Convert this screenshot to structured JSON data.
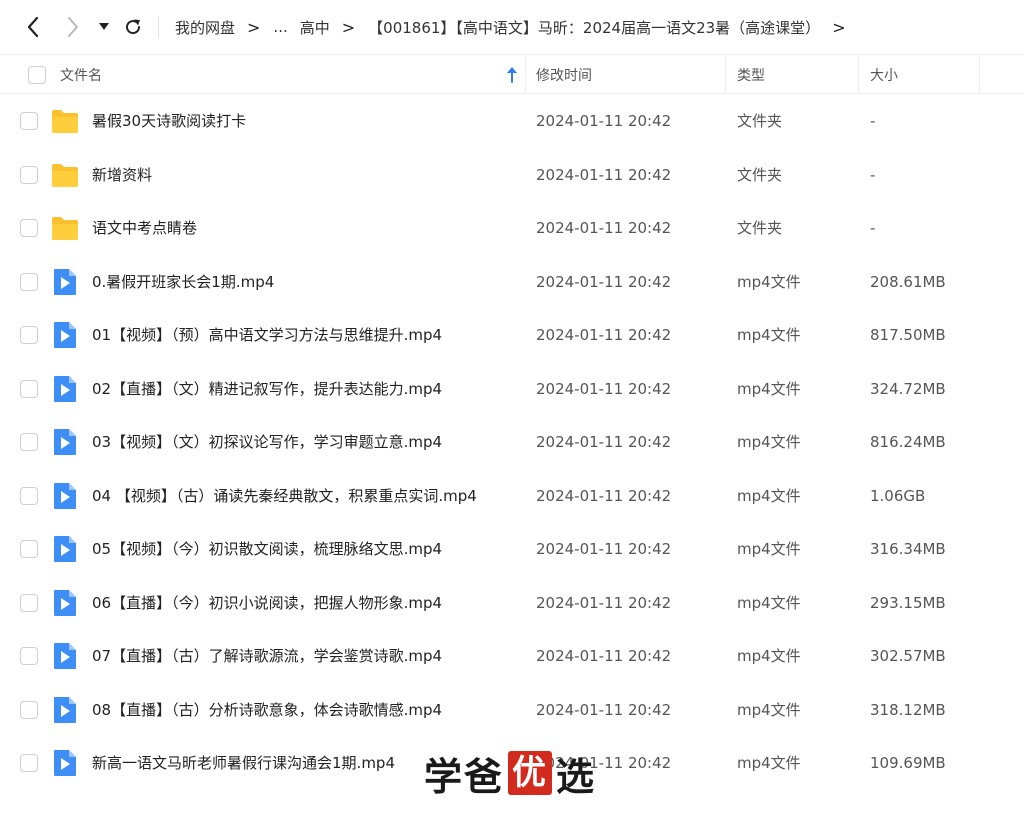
{
  "breadcrumb": {
    "root": "我的网盘",
    "ellipsis": "...",
    "level1": "高中",
    "current": "【001861】【高中语文】马昕：2024届高一语文23暑（高途课堂）"
  },
  "columns": {
    "name": "文件名",
    "modified": "修改时间",
    "type": "类型",
    "size": "大小"
  },
  "files": [
    {
      "name": "暑假30天诗歌阅读打卡",
      "modified": "2024-01-11 20:42",
      "type": "文件夹",
      "size": "-",
      "icon": "folder-icon"
    },
    {
      "name": "新增资料",
      "modified": "2024-01-11 20:42",
      "type": "文件夹",
      "size": "-",
      "icon": "folder-icon"
    },
    {
      "name": "语文中考点睛卷",
      "modified": "2024-01-11 20:42",
      "type": "文件夹",
      "size": "-",
      "icon": "folder-icon"
    },
    {
      "name": "0.暑假开班家长会1期.mp4",
      "modified": "2024-01-11 20:42",
      "type": "mp4文件",
      "size": "208.61MB",
      "icon": "video-file-icon"
    },
    {
      "name": "01【视频】（预）高中语文学习方法与思维提升.mp4",
      "modified": "2024-01-11 20:42",
      "type": "mp4文件",
      "size": "817.50MB",
      "icon": "video-file-icon"
    },
    {
      "name": "02【直播】（文）精进记叙写作，提升表达能力.mp4",
      "modified": "2024-01-11 20:42",
      "type": "mp4文件",
      "size": "324.72MB",
      "icon": "video-file-icon"
    },
    {
      "name": "03【视频】（文）初探议论写作，学习审题立意.mp4",
      "modified": "2024-01-11 20:42",
      "type": "mp4文件",
      "size": "816.24MB",
      "icon": "video-file-icon"
    },
    {
      "name": "04 【视频】（古）诵读先秦经典散文，积累重点实词.mp4",
      "modified": "2024-01-11 20:42",
      "type": "mp4文件",
      "size": "1.06GB",
      "icon": "video-file-icon"
    },
    {
      "name": "05【视频】（今）初识散文阅读，梳理脉络文思.mp4",
      "modified": "2024-01-11 20:42",
      "type": "mp4文件",
      "size": "316.34MB",
      "icon": "video-file-icon"
    },
    {
      "name": "06【直播】（今）初识小说阅读，把握人物形象.mp4",
      "modified": "2024-01-11 20:42",
      "type": "mp4文件",
      "size": "293.15MB",
      "icon": "video-file-icon"
    },
    {
      "name": "07【直播】（古）了解诗歌源流，学会鉴赏诗歌.mp4",
      "modified": "2024-01-11 20:42",
      "type": "mp4文件",
      "size": "302.57MB",
      "icon": "video-file-icon"
    },
    {
      "name": "08【直播】（古）分析诗歌意象，体会诗歌情感.mp4",
      "modified": "2024-01-11 20:42",
      "type": "mp4文件",
      "size": "318.12MB",
      "icon": "video-file-icon"
    },
    {
      "name": "新高一语文马昕老师暑假行课沟通会1期.mp4",
      "modified": "2024-01-11 20:42",
      "type": "mp4文件",
      "size": "109.69MB",
      "icon": "video-file-icon"
    }
  ],
  "watermark": {
    "part1": "学爸",
    "seal": "优",
    "part2": "选"
  },
  "colors": {
    "folder": "#FBC02D",
    "video": "#3E8EF7",
    "sort_arrow": "#2F7CF6",
    "watermark_seal": "#D22A1D"
  }
}
